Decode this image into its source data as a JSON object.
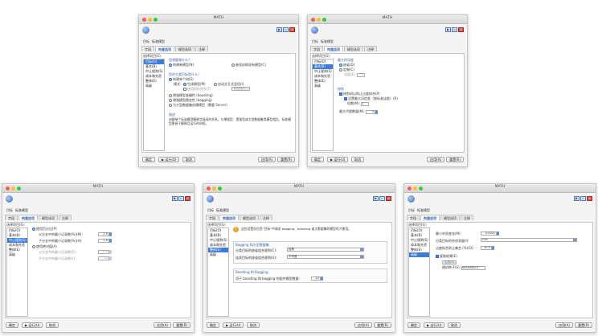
{
  "window_title": "MATH",
  "target_label": "目标",
  "target_value": "标准模型",
  "tabs": [
    "字段",
    "构建选项",
    "模型选项",
    "注释"
  ],
  "select_items_label": "选择项目(S):",
  "left_items": [
    "目标(O)",
    "基本(B)",
    "中止规则(S)",
    "成本和先验",
    "整体(E)",
    "高级"
  ],
  "buttons": {
    "ok": "确定",
    "run": "运行(U)",
    "cancel": "取消",
    "apply": "应用(A)",
    "reset": "重置(R)"
  },
  "win1": {
    "q1": "您想要做什么？",
    "opt_build": "构建新模型(N)",
    "opt_continue": "继续训练现有模型(C)",
    "q2": "您的主要目标是什么？",
    "opt_single": "构建单个树(S)",
    "mode_label": "模式：",
    "opt_gen_model": "生成模型(M)",
    "opt_interactive": "启动交互式会话(I)",
    "use_tree_dir": "使用树形指令(T)",
    "tree_dir_btn": "树形指令...",
    "opt_boost": "增强模型准确性 (boosting)",
    "opt_bag": "增强模型稳定性 (bagging)",
    "opt_server": "为大型数据集创建模型（需要 Server）",
    "desc_title": "描述",
    "desc_text": "创建单个标准模型解释字段间的关系。与增强型、提拔型或大型数据集等模型相比，标准模型更易于解释且运行时间短。"
  },
  "win2": {
    "sec1": "最大树深度",
    "opt_default": "缺省(D)",
    "opt_custom": "定制(C)",
    "depth_label": "深度(E):",
    "depth_value": "5",
    "sec2": "修剪",
    "chk_prune": "修剪树以防止过度拟合(P)",
    "chk_std_err": "设置最大风险差（按标准误差）(R)",
    "multiplier_label": "倍数(M):",
    "multiplier_value": "1",
    "max_surrogates_label": "最大代理数量(M):",
    "max_surrogates_value": "5"
  },
  "win3": {
    "opt_pct": "使用百分比(P)",
    "parent_pct_label": "父分支中的最小记录数(%)(M):",
    "parent_pct_value": "2.0",
    "child_pct_label": "子分支中的最小记录数(%)(H):",
    "child_pct_value": "1.0",
    "opt_abs": "使用绝对值(A)",
    "parent_abs_label": "父分支中的最小记录数(E):",
    "parent_abs_value": "100",
    "child_abs_label": "子分支中的最小记录数(L):",
    "child_abs_value": "50"
  },
  "win4": {
    "warn_text": "这些设置仅在您“目标”中请求 bagging、boosting 或大数据集的模型时才使用。",
    "sec_bagging": "Bagging 和大型数据集",
    "cat_label": "分类目标的缺省组合规则(C):",
    "cat_value": "投票",
    "cont_label": "连续目标的缺省组合规则(U):",
    "cont_value": "平均值",
    "sec_boost": "Boosting 和 Bagging",
    "num_models_label": "用于 boosting 和 bagging 的组件模型数量:",
    "num_models_value": "10"
  },
  "win5": {
    "min_impurity_label": "最小杂质变化(M):",
    "min_impurity_value": "0.0001",
    "impurity_measure_label": "分类目标的杂质测量(I):",
    "impurity_measure_value": "Gini",
    "overfit_label": "过度拟合防止集合 (%)(O):",
    "overfit_value": "30.0",
    "chk_replicate": "复制结果(E)",
    "generate_btn": "生成(G)",
    "seed_label": "随机种子(S):",
    "seed_value": "681648021"
  }
}
